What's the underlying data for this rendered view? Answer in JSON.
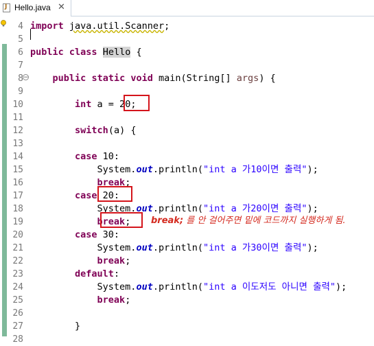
{
  "tab": {
    "title": "Hello.java",
    "close": "✕"
  },
  "lines": [
    {
      "n": "4",
      "tokens": [
        {
          "t": "import",
          "c": "kw"
        },
        {
          "t": " "
        },
        {
          "t": "java.util.Scanner",
          "c": "wavy"
        },
        {
          "t": ";"
        }
      ]
    },
    {
      "n": "5",
      "tokens": []
    },
    {
      "n": "6",
      "tokens": [
        {
          "t": "public",
          "c": "kw"
        },
        {
          "t": " "
        },
        {
          "t": "class",
          "c": "kw"
        },
        {
          "t": " "
        },
        {
          "t": "Hello",
          "c": "cls"
        },
        {
          "t": " {"
        }
      ]
    },
    {
      "n": "7",
      "tokens": []
    },
    {
      "n": "8",
      "fold": "⊖",
      "tokens": [
        {
          "t": "    "
        },
        {
          "t": "public",
          "c": "kw"
        },
        {
          "t": " "
        },
        {
          "t": "static",
          "c": "kw"
        },
        {
          "t": " "
        },
        {
          "t": "void",
          "c": "kw"
        },
        {
          "t": " main(String[] "
        },
        {
          "t": "args",
          "c": "kw-plain"
        },
        {
          "t": ") {"
        }
      ]
    },
    {
      "n": "9",
      "tokens": []
    },
    {
      "n": "10",
      "tokens": [
        {
          "t": "        "
        },
        {
          "t": "int",
          "c": "kw"
        },
        {
          "t": " a = 20;"
        }
      ]
    },
    {
      "n": "11",
      "tokens": []
    },
    {
      "n": "12",
      "tokens": [
        {
          "t": "        "
        },
        {
          "t": "switch",
          "c": "kw"
        },
        {
          "t": "(a) {"
        }
      ]
    },
    {
      "n": "13",
      "tokens": []
    },
    {
      "n": "14",
      "tokens": [
        {
          "t": "        "
        },
        {
          "t": "case",
          "c": "kw"
        },
        {
          "t": " 10:"
        }
      ]
    },
    {
      "n": "15",
      "tokens": [
        {
          "t": "            System."
        },
        {
          "t": "out",
          "c": "fld"
        },
        {
          "t": ".println("
        },
        {
          "t": "\"int a 가10이면 출력\"",
          "c": "str"
        },
        {
          "t": ");"
        }
      ]
    },
    {
      "n": "16",
      "tokens": [
        {
          "t": "            "
        },
        {
          "t": "break",
          "c": "kw"
        },
        {
          "t": ";"
        }
      ]
    },
    {
      "n": "17",
      "tokens": [
        {
          "t": "        "
        },
        {
          "t": "case",
          "c": "kw"
        },
        {
          "t": " 20:"
        }
      ]
    },
    {
      "n": "18",
      "tokens": [
        {
          "t": "            System."
        },
        {
          "t": "out",
          "c": "fld"
        },
        {
          "t": ".println("
        },
        {
          "t": "\"int a 가20이면 출력\"",
          "c": "str"
        },
        {
          "t": ");"
        }
      ]
    },
    {
      "n": "19",
      "tokens": [
        {
          "t": "            "
        },
        {
          "t": "break",
          "c": "kw"
        },
        {
          "t": ";"
        }
      ]
    },
    {
      "n": "20",
      "tokens": [
        {
          "t": "        "
        },
        {
          "t": "case",
          "c": "kw"
        },
        {
          "t": " 30:"
        }
      ]
    },
    {
      "n": "21",
      "tokens": [
        {
          "t": "            System."
        },
        {
          "t": "out",
          "c": "fld"
        },
        {
          "t": ".println("
        },
        {
          "t": "\"int a 가30이면 출력\"",
          "c": "str"
        },
        {
          "t": ");"
        }
      ]
    },
    {
      "n": "22",
      "tokens": [
        {
          "t": "            "
        },
        {
          "t": "break",
          "c": "kw"
        },
        {
          "t": ";"
        }
      ]
    },
    {
      "n": "23",
      "tokens": [
        {
          "t": "        "
        },
        {
          "t": "default",
          "c": "kw"
        },
        {
          "t": ":"
        }
      ]
    },
    {
      "n": "24",
      "tokens": [
        {
          "t": "            System."
        },
        {
          "t": "out",
          "c": "fld"
        },
        {
          "t": ".println("
        },
        {
          "t": "\"int a 이도저도 아니면 출력\"",
          "c": "str"
        },
        {
          "t": ");"
        }
      ]
    },
    {
      "n": "25",
      "tokens": [
        {
          "t": "            "
        },
        {
          "t": "break",
          "c": "kw"
        },
        {
          "t": ";"
        }
      ]
    },
    {
      "n": "26",
      "tokens": []
    },
    {
      "n": "27",
      "tokens": [
        {
          "t": "        }"
        }
      ]
    },
    {
      "n": "28",
      "tokens": []
    }
  ],
  "annotation": {
    "keyword": "break;",
    "text": " 를 안 걸어주면 밑에 코드까지 실행하게 됨."
  },
  "colors": {
    "keyword": "#7f0055",
    "string": "#2a00ff",
    "field": "#0000c0",
    "highlight_box": "#d4141b",
    "change_ruler": "#7fb99a"
  }
}
